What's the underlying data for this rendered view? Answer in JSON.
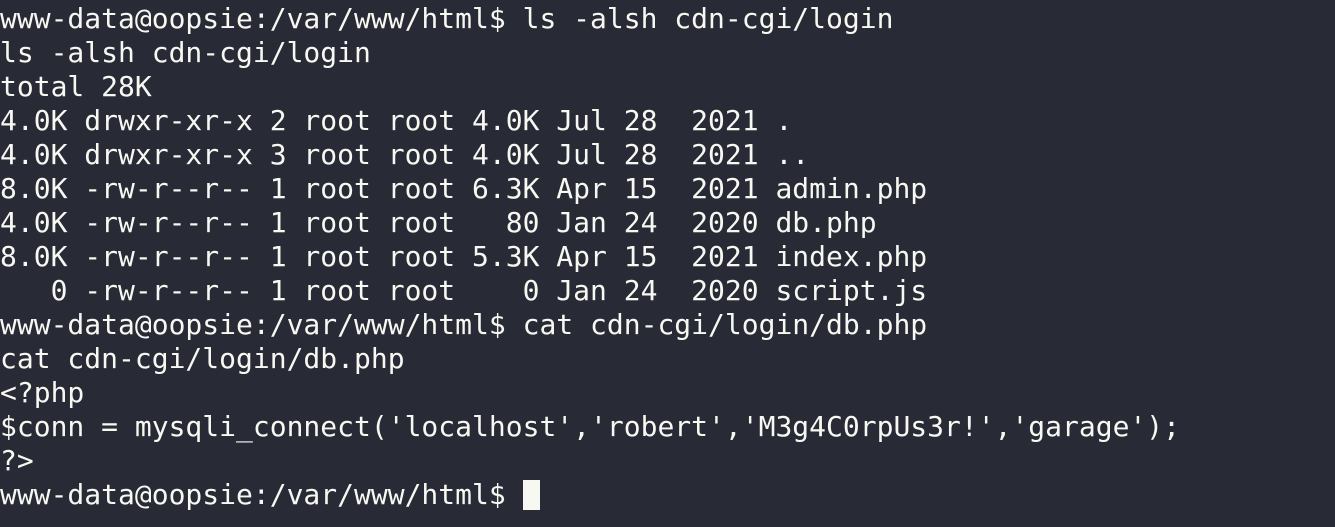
{
  "terminal": {
    "lines": [
      "www-data@oopsie:/var/www/html$ ls -alsh cdn-cgi/login",
      "ls -alsh cdn-cgi/login",
      "total 28K",
      "4.0K drwxr-xr-x 2 root root 4.0K Jul 28  2021 .",
      "4.0K drwxr-xr-x 3 root root 4.0K Jul 28  2021 ..",
      "8.0K -rw-r--r-- 1 root root 6.3K Apr 15  2021 admin.php",
      "4.0K -rw-r--r-- 1 root root   80 Jan 24  2020 db.php",
      "8.0K -rw-r--r-- 1 root root 5.3K Apr 15  2021 index.php",
      "   0 -rw-r--r-- 1 root root    0 Jan 24  2020 script.js",
      "www-data@oopsie:/var/www/html$ cat cdn-cgi/login/db.php",
      "cat cdn-cgi/login/db.php",
      "<?php",
      "$conn = mysqli_connect('localhost','robert','M3g4C0rpUs3r!','garage');",
      "?>"
    ],
    "prompt": "www-data@oopsie:/var/www/html$ ",
    "colors": {
      "background": "#282a36",
      "foreground": "#f8f8f2"
    }
  }
}
